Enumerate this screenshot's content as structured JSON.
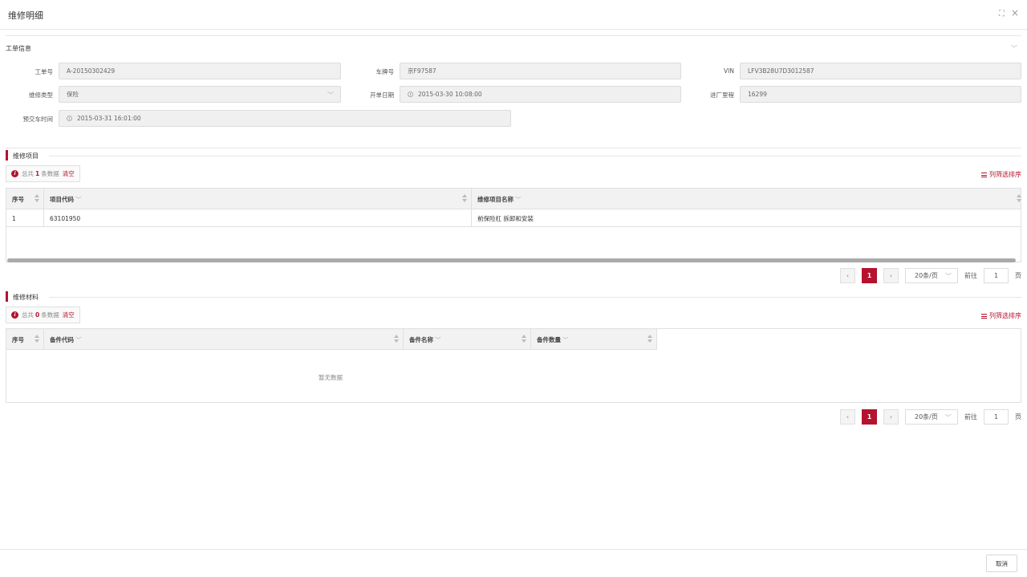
{
  "dialog": {
    "title": "维修明细",
    "fullscreen_icon": "⛶",
    "close_icon": "×"
  },
  "work_order": {
    "section_label": "工单信息",
    "fields": {
      "order_no_label": "工单号",
      "order_no_value": "A-20150302429",
      "plate_label": "车牌号",
      "plate_value": "京F97587",
      "vin_label": "VIN",
      "vin_value": "LFV3B28U7D3012587",
      "repair_type_label": "维修类型",
      "repair_type_value": "保险",
      "open_date_label": "开单日期",
      "open_date_value": "2015-03-30 10:08:00",
      "mileage_label": "进厂里程",
      "mileage_value": "16299",
      "delivery_time_label": "预交车时间",
      "delivery_time_value": "2015-03-31 16:01:00"
    }
  },
  "repair_items": {
    "section_label": "维修项目",
    "info_prefix": "总共",
    "info_count": "1",
    "info_suffix": "条数据",
    "clear_label": "清空",
    "column_filter_label": "列筛选排序",
    "columns": [
      "序号",
      "项目代码",
      "维修项目名称"
    ],
    "rows": [
      {
        "seq": "1",
        "code": "63101950",
        "name": "前保险杠 拆卸和安装"
      }
    ],
    "pager": {
      "current": "1",
      "page_size": "20条/页",
      "goto_label": "前往",
      "goto_value": "1",
      "page_unit": "页"
    }
  },
  "repair_materials": {
    "section_label": "维修材料",
    "info_prefix": "总共",
    "info_count": "0",
    "info_suffix": "条数据",
    "clear_label": "清空",
    "column_filter_label": "列筛选排序",
    "columns": [
      "序号",
      "备件代码",
      "备件名称",
      "备件数量"
    ],
    "empty_text": "暂无数据",
    "pager": {
      "current": "1",
      "page_size": "20条/页",
      "goto_label": "前往",
      "goto_value": "1",
      "page_unit": "页"
    }
  },
  "footer": {
    "cancel_label": "取消"
  },
  "colors": {
    "accent": "#b5122e"
  }
}
